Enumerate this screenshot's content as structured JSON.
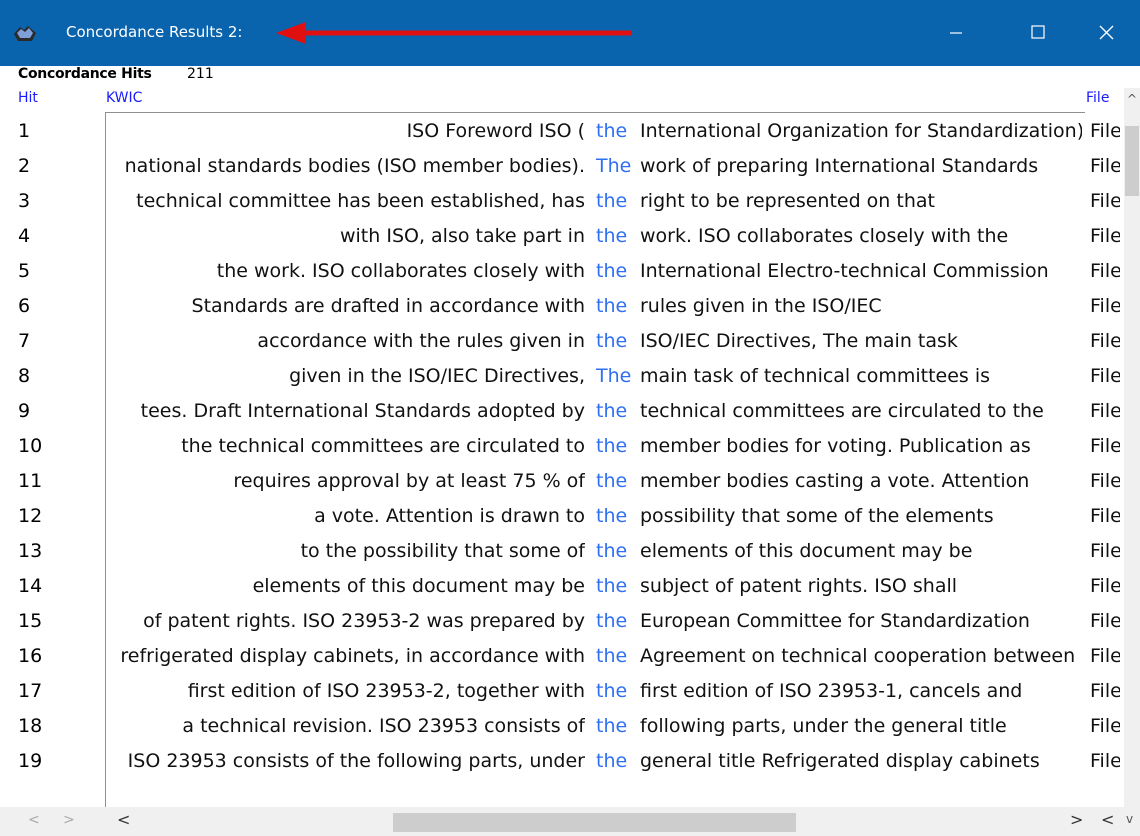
{
  "window": {
    "title": "Concordance Results 2:",
    "icon": "concordance-app-icon",
    "minimize_icon": "minimize-icon",
    "maximize_icon": "maximize-icon",
    "close_icon": "close-icon",
    "titlebar_color": "#0a64ad",
    "annotation_arrow_color": "#e01010"
  },
  "summary": {
    "label": "Concordance Hits",
    "count": "211"
  },
  "columns": {
    "hit": "Hit",
    "kwic": "KWIC",
    "file": "File"
  },
  "keyword_color": "#2f6ff2",
  "rows": [
    {
      "hit": "1",
      "left": "ISO  Foreword  ISO (",
      "kw": "the",
      "right": "International Organization for Standardization)",
      "file": "File"
    },
    {
      "hit": "2",
      "left": "national standards  bodies (ISO member bodies).",
      "kw": "The",
      "right": "work of preparing International Standards",
      "file": "File"
    },
    {
      "hit": "3",
      "left": "technical committee has been established, has",
      "kw": "the",
      "right": "right to be represented on that",
      "file": "File"
    },
    {
      "hit": "4",
      "left": "with ISO, also take part in",
      "kw": "the",
      "right": "work. ISO collaborates closely with the",
      "file": "File"
    },
    {
      "hit": "5",
      "left": "the work. ISO collaborates closely with",
      "kw": "the",
      "right": "International Electro-technical Commission",
      "file": "File"
    },
    {
      "hit": "6",
      "left": "Standards are drafted in accordance with",
      "kw": "the",
      "right": "rules given in the ISO/IEC",
      "file": "File"
    },
    {
      "hit": "7",
      "left": "accordance with the rules given in",
      "kw": "the",
      "right": "ISO/IEC Directives,   The main task",
      "file": "File"
    },
    {
      "hit": "8",
      "left": "given in the ISO/IEC Directives,",
      "kw": "The",
      "right": "main task of technical committees is",
      "file": "File"
    },
    {
      "hit": "9",
      "left": "tees. Draft International  Standards adopted by",
      "kw": "the",
      "right": "technical committees are circulated to the",
      "file": "File"
    },
    {
      "hit": "10",
      "left": "the technical committees are circulated to",
      "kw": "the",
      "right": "member bodies for voting.  Publication as",
      "file": "File"
    },
    {
      "hit": "11",
      "left": "requires approval by at least 75 % of",
      "kw": "the",
      "right": "member bodies  casting a vote. Attention",
      "file": "File"
    },
    {
      "hit": "12",
      "left": "a vote. Attention is drawn to",
      "kw": "the",
      "right": "possibility that some of the elements",
      "file": "File"
    },
    {
      "hit": "13",
      "left": "to the possibility that some of",
      "kw": "the",
      "right": "elements of this document may be",
      "file": "File"
    },
    {
      "hit": "14",
      "left": "elements of this document may be",
      "kw": "the",
      "right": "subject  of patent rights. ISO shall",
      "file": "File"
    },
    {
      "hit": "15",
      "left": "of patent rights.  ISO 23953-2 was prepared by",
      "kw": "the",
      "right": "European Committee for Standardization",
      "file": "File"
    },
    {
      "hit": "16",
      "left": "refrigerated display cabinets, in accordance  with",
      "kw": "the",
      "right": "Agreement on technical cooperation between",
      "file": "File"
    },
    {
      "hit": "17",
      "left": "first edition of ISO 23953-2, together with",
      "kw": "the",
      "right": "first edition of ISO 23953-1, cancels and",
      "file": "File"
    },
    {
      "hit": "18",
      "left": "a technical revision.  ISO 23953 consists of",
      "kw": "the",
      "right": "following parts, under the general title",
      "file": "File"
    },
    {
      "hit": "19",
      "left": "ISO 23953 consists of the following parts, under",
      "kw": "the",
      "right": "general title  Refrigerated display cabinets",
      "file": "File"
    }
  ],
  "scrollbars": {
    "up_arrow": "^",
    "down_arrow": "v",
    "left_arrow": "<",
    "right_arrow": ">"
  }
}
